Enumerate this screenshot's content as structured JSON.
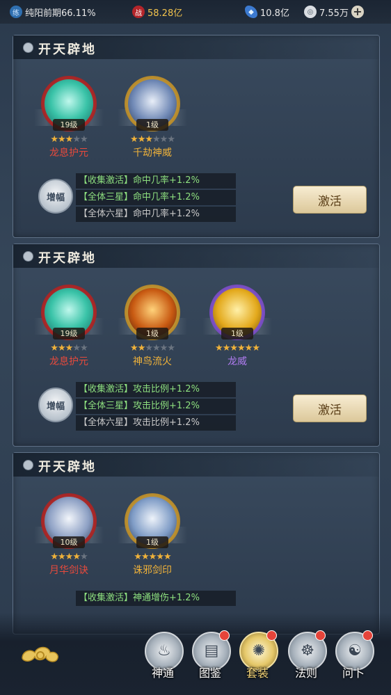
{
  "topbar": {
    "realm": "纯阳前期66.11%",
    "power": "58.28亿",
    "currency1": "10.8亿",
    "currency2": "7.55万"
  },
  "panels": [
    {
      "title": "开天辟地",
      "skills": [
        {
          "level": "19级",
          "name": "龙息护元",
          "stars_filled": 3,
          "stars_total": 5,
          "name_color": "#e84a3c"
        },
        {
          "level": "1级",
          "name": "千劫神威",
          "stars_filled": 3,
          "stars_total": 6,
          "name_color": "#f0b23a"
        }
      ],
      "badge": "增幅",
      "effects": [
        "【收集激活】命中几率+1.2%",
        "【全体三星】命中几率+1.2%",
        "【全体六星】命中几率+1.2%"
      ],
      "activate": "激活"
    },
    {
      "title": "开天辟地",
      "skills": [
        {
          "level": "19级",
          "name": "龙息护元",
          "stars_filled": 3,
          "stars_total": 5,
          "name_color": "#e84a3c"
        },
        {
          "level": "1级",
          "name": "神鸟流火",
          "stars_filled": 2,
          "stars_total": 6,
          "name_color": "#f0b23a"
        },
        {
          "level": "1级",
          "name": "龙威",
          "stars_filled": 6,
          "stars_total": 6,
          "name_color": "#b07cf0"
        }
      ],
      "badge": "增幅",
      "effects": [
        "【收集激活】攻击比例+1.2%",
        "【全体三星】攻击比例+1.2%",
        "【全体六星】攻击比例+1.2%"
      ],
      "activate": "激活"
    },
    {
      "title": "开天辟地",
      "skills": [
        {
          "level": "10级",
          "name": "月华剑诀",
          "stars_filled": 4,
          "stars_total": 5,
          "name_color": "#e84a3c"
        },
        {
          "level": "1级",
          "name": "诛邪剑印",
          "stars_filled": 5,
          "stars_total": 5,
          "name_color": "#f0b23a"
        }
      ],
      "effects": [
        "【收集激活】神通增伤+1.2%"
      ]
    }
  ],
  "nav": [
    {
      "label": "神通",
      "icon": "flame-spirit-icon",
      "dot": false
    },
    {
      "label": "图鉴",
      "icon": "book-icon",
      "dot": true
    },
    {
      "label": "套装",
      "icon": "fan-icon",
      "dot": true,
      "active": true
    },
    {
      "label": "法则",
      "icon": "mask-icon",
      "dot": true
    },
    {
      "label": "问卜",
      "icon": "fortune-icon",
      "dot": true
    }
  ],
  "colors": {
    "accent_gold": "#f0b23a",
    "red_name": "#e84a3c",
    "purple_name": "#b07cf0",
    "green_effect": "#8ddf7f"
  }
}
